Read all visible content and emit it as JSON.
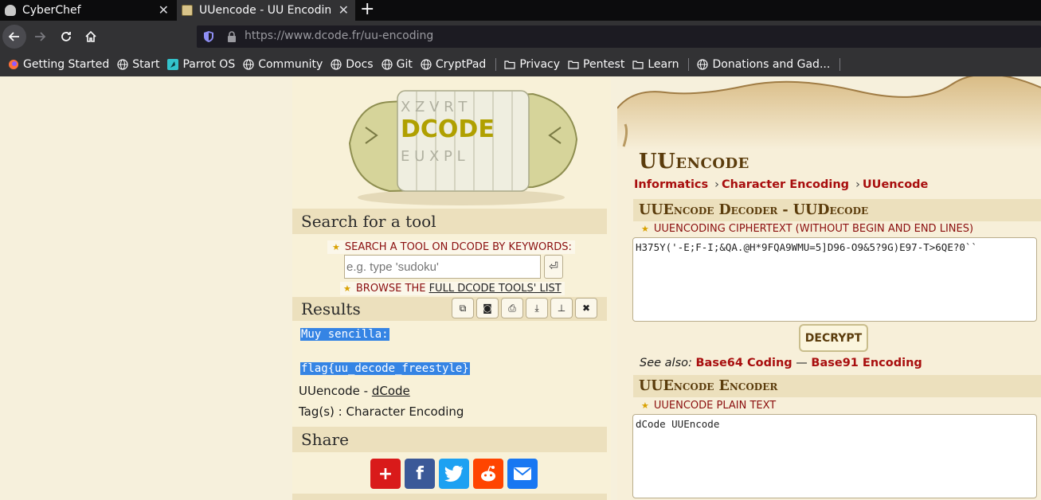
{
  "browser": {
    "tabs": [
      {
        "title": "CyberChef",
        "active": false
      },
      {
        "title": "UUencode - UU Encoding",
        "active": true
      }
    ],
    "new_tab": "+",
    "close_glyph": "✕",
    "url_host": "https://www.dcode.fr",
    "url_path": "/uu-encoding",
    "bookmarks": [
      {
        "label": "Getting Started",
        "icon": "firefox-icon"
      },
      {
        "label": "Start",
        "icon": "globe-icon"
      },
      {
        "label": "Parrot OS",
        "icon": "parrot-icon"
      },
      {
        "label": "Community",
        "icon": "globe-icon"
      },
      {
        "label": "Docs",
        "icon": "globe-icon"
      },
      {
        "label": "Git",
        "icon": "globe-icon"
      },
      {
        "label": "CryptPad",
        "icon": "globe-icon"
      },
      {
        "label": "Privacy",
        "icon": "folder-icon"
      },
      {
        "label": "Pentest",
        "icon": "folder-icon"
      },
      {
        "label": "Learn",
        "icon": "folder-icon"
      },
      {
        "label": "Donations and Gad...",
        "icon": "globe-icon"
      }
    ]
  },
  "sidebar": {
    "logo_text": "DCODE",
    "search_title": "Search for a tool",
    "search_keywords_label": "SEARCH A TOOL ON DCODE BY KEYWORDS:",
    "search_placeholder": "e.g. type 'sudoku'",
    "search_go": "⏎",
    "browse_prefix": "BROWSE THE ",
    "browse_link": "FULL DCODE TOOLS' LIST",
    "results_title": "Results",
    "result_lines": [
      "Muy sencilla:",
      "flag{uu_decode_freestyle}"
    ],
    "result_source_prefix": "UUencode - ",
    "result_source_link": "dCode",
    "result_tags": "Tag(s) : Character Encoding",
    "share_title": "Share"
  },
  "main": {
    "title": "UUencode",
    "breadcrumbs": [
      "Informatics",
      "Character Encoding",
      "UUencode"
    ],
    "breadcrumb_sep": "›",
    "decoder_title": "UUEncode Decoder - UUDecode",
    "ciphertext_label": "UUENCODING CIPHERTEXT (WITHOUT BEGIN AND END LINES)",
    "ciphertext_value": "H375Y('-E;F-I;&QA.@H*9FQA9WMU=5]D96-O9&5?9G)E97-T>6QE?0``",
    "decrypt_label": "DECRYPT",
    "see_also_prefix": "See also:",
    "see_also_1": "Base64 Coding",
    "see_also_sep": "—",
    "see_also_2": "Base91 Encoding",
    "encoder_title": "UUEncode Encoder",
    "plaintext_label": "UUENCODE PLAIN TEXT",
    "plaintext_value": "dCode UUEncode"
  },
  "colors": {
    "accent_red": "#a80e0e",
    "title_brown": "#5b3c0c",
    "highlight": "#3584e4",
    "section_bg": "#ece0bd"
  }
}
